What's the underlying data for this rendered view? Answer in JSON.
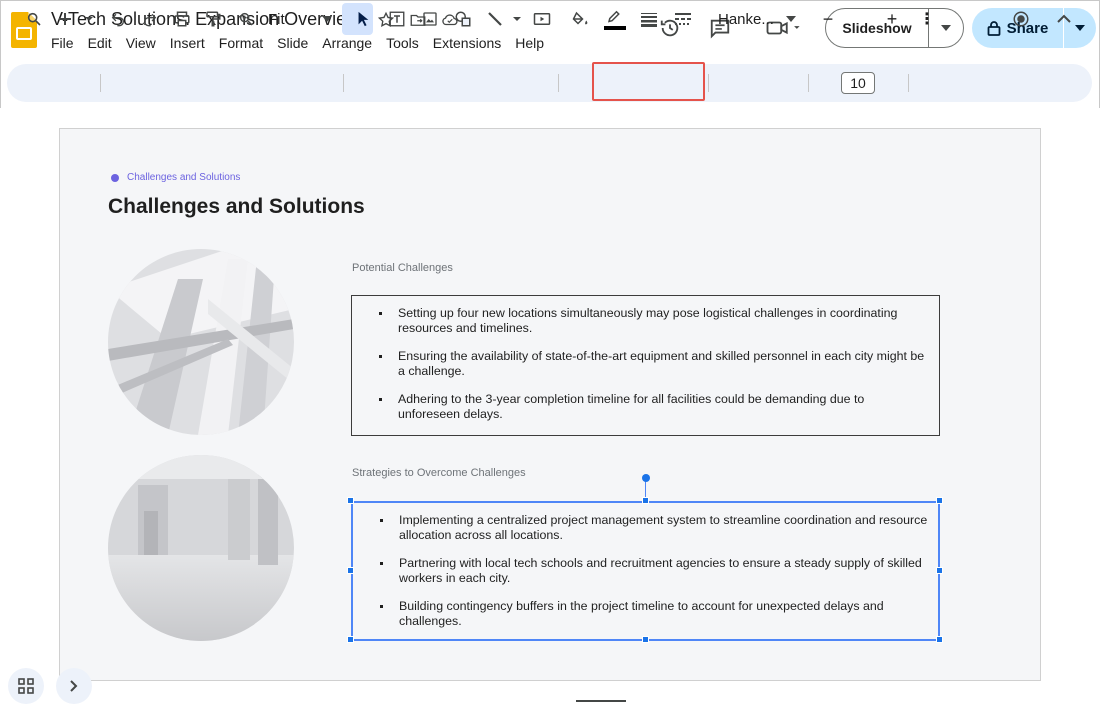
{
  "app": {
    "title": "V-Tech Solutions: Expansion Overview"
  },
  "menu": [
    "File",
    "Edit",
    "View",
    "Insert",
    "Format",
    "Slide",
    "Arrange",
    "Tools",
    "Extensions",
    "Help"
  ],
  "header": {
    "slideshow_label": "Slideshow",
    "share_label": "Share"
  },
  "toolbar": {
    "zoom_label": "Fit",
    "font_label": "Hanke...",
    "font_size": "10",
    "minus_label": "−",
    "plus_label": "+",
    "more_label": "⋮"
  },
  "slide": {
    "subtitle": "Challenges and Solutions",
    "title": "Challenges and Solutions",
    "section1_label": "Potential Challenges",
    "section1_items": [
      "Setting up four new locations simultaneously may pose logistical challenges in coordinating resources and timelines.",
      "Ensuring the availability of state-of-the-art equipment and skilled personnel in each city might be a challenge.",
      "Adhering to the 3-year completion timeline for all facilities could be demanding due to unforeseen delays."
    ],
    "section2_label": "Strategies to Overcome Challenges",
    "section2_items": [
      "Implementing a centralized project management system to streamline coordination and resource allocation across all locations.",
      "Partnering with local tech schools and recruitment agencies to ensure a steady supply of skilled workers in each city.",
      "Building contingency buffers in the project timeline to account for unexpected delays and challenges."
    ]
  },
  "colors": {
    "accent": "#6c63e0",
    "selection": "#1a73e8",
    "share_bg": "#c2e7ff",
    "highlight": "#e5534b"
  }
}
